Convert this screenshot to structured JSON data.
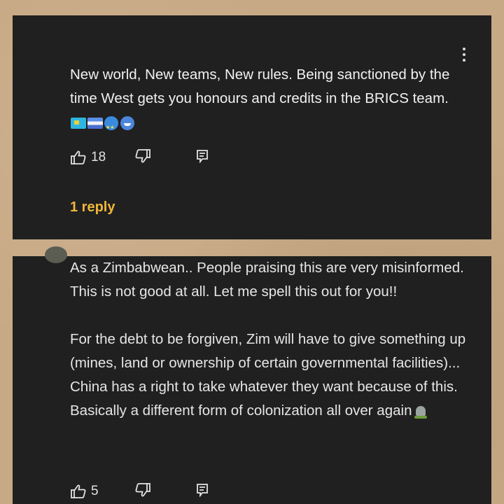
{
  "comment_1": {
    "text": "New world, New teams, New rules. Being sanctioned by the time West gets you honours and credits in the BRICS team.",
    "emoji": [
      "flag-of-kazakhstan",
      "flag",
      "star-struck-face",
      "grinning-face"
    ],
    "likes": "18",
    "replies_label": "1 reply"
  },
  "comment_2": {
    "paragraph_1": "As a Zimbabwean.. People praising this are very misinformed. This is not good at all. Let me spell this out for you!!",
    "paragraph_2": "For the debt to be forgiven, Zim will have to give something up (mines, land or ownership of certain governmental facilities)... China has a right to take whatever they want because of this. Basically a different form of colonization all over again",
    "emoji": [
      "headstone"
    ],
    "likes": "5"
  },
  "colors": {
    "background": "#c8a985",
    "card": "#202020",
    "text": "#f1f1f1",
    "reply_link": "#f0b63a"
  }
}
